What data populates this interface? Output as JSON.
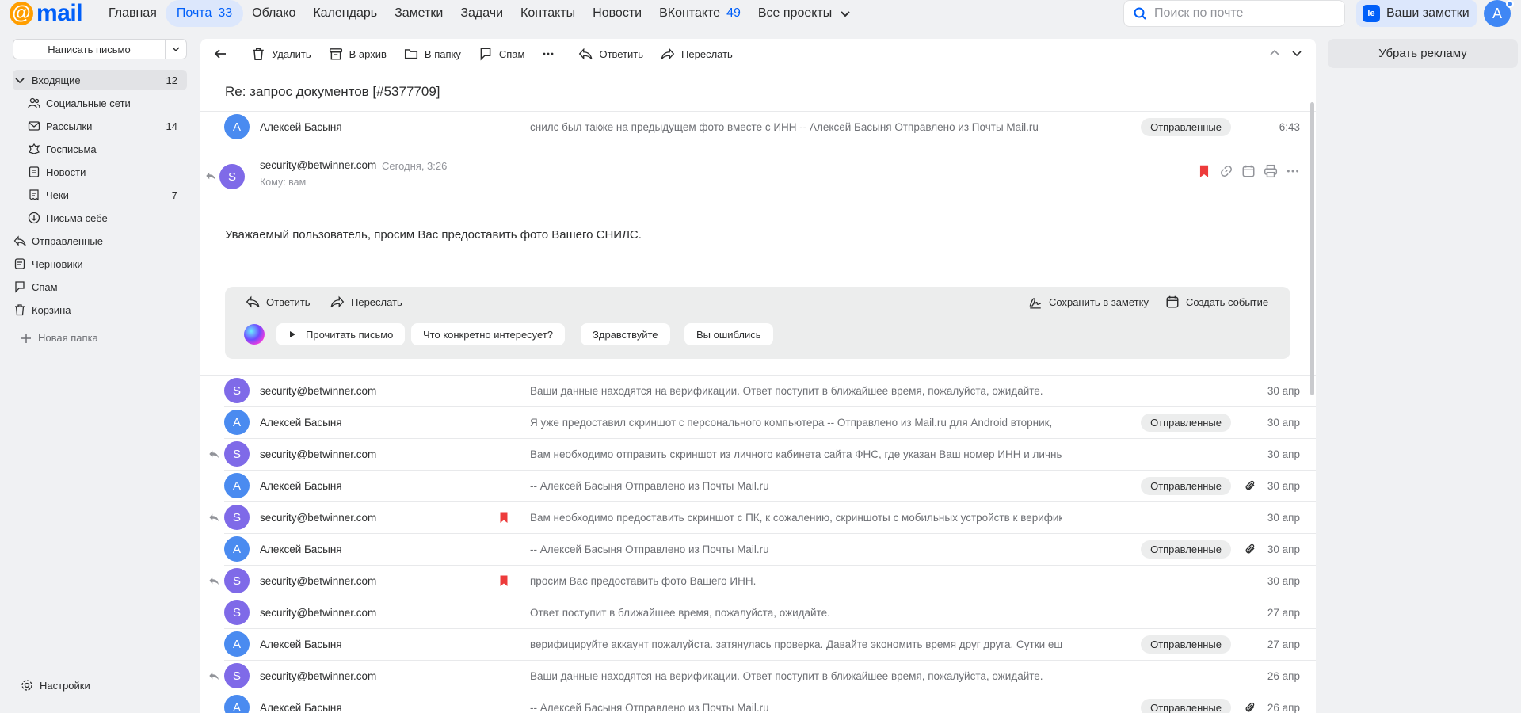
{
  "brand": {
    "logo_at": "@",
    "logo_word": "mail"
  },
  "nav": [
    {
      "label": "Главная",
      "count": ""
    },
    {
      "label": "Почта",
      "count": "33",
      "active": true
    },
    {
      "label": "Облако",
      "count": ""
    },
    {
      "label": "Календарь",
      "count": ""
    },
    {
      "label": "Заметки",
      "count": ""
    },
    {
      "label": "Задачи",
      "count": ""
    },
    {
      "label": "Контакты",
      "count": ""
    },
    {
      "label": "Новости",
      "count": ""
    },
    {
      "label": "ВКонтакте",
      "count": "49"
    },
    {
      "label": "Все проекты",
      "count": ""
    }
  ],
  "search": {
    "placeholder": "Поиск по почте"
  },
  "notes_button": {
    "icon_text": "le",
    "label": "Ваши заметки"
  },
  "user": {
    "avatar": "A"
  },
  "compose": {
    "label": "Написать письмо"
  },
  "folders": [
    {
      "label": "Входящие",
      "count": "12"
    },
    {
      "label": "Социальные сети",
      "count": ""
    },
    {
      "label": "Рассылки",
      "count": "14"
    },
    {
      "label": "Госписьма",
      "count": ""
    },
    {
      "label": "Новости",
      "count": ""
    },
    {
      "label": "Чеки",
      "count": "7"
    },
    {
      "label": "Письма себе",
      "count": ""
    },
    {
      "label": "Отправленные",
      "count": ""
    },
    {
      "label": "Черновики",
      "count": ""
    },
    {
      "label": "Спам",
      "count": ""
    },
    {
      "label": "Корзина",
      "count": ""
    }
  ],
  "new_folder": "Новая папка",
  "settings": "Настройки",
  "toolbar": {
    "delete": "Удалить",
    "archive": "В архив",
    "to_folder": "В папку",
    "spam": "Спам",
    "reply": "Ответить",
    "forward": "Переслать"
  },
  "thread": {
    "subject": "Re: запрос документов [#5377709]",
    "first": {
      "avatar": "A",
      "sender": "Алексей Басыня",
      "snippet": "снилс был также на предыдущем фото вместе с ИНН -- Алексей Басыня Отправлено из Почты Mail.ru",
      "tag": "Отправленные",
      "date": "6:43"
    },
    "open": {
      "avatar": "S",
      "from": "security@betwinner.com",
      "time": "Сегодня, 3:26",
      "to": "Кому: вам",
      "body": "Уважаемый пользователь, просим Вас предоставить фото Вашего СНИЛС."
    },
    "actions": {
      "reply": "Ответить",
      "forward": "Переслать",
      "save_note": "Сохранить в заметку",
      "create_event": "Создать событие",
      "read_letter": "Прочитать письмо",
      "chips": [
        "Что конкретно интересует?",
        "Здравствуйте",
        "Вы ошиблись"
      ]
    },
    "rows": [
      {
        "avatar": "S",
        "sender": "security@betwinner.com",
        "snippet": "Ваши данные находятся на верификации. Ответ поступит в ближайшее время, пожалуйста, ожидайте.",
        "tag": "",
        "date": "30 апр",
        "replied": false,
        "flag": false,
        "clip": false
      },
      {
        "avatar": "A",
        "sender": "Алексей Басыня",
        "snippet": "Я уже предоставил скриншот с персонального компьютера -- Отправлено из Mail.ru для Android вторник,",
        "tag": "Отправленные",
        "date": "30 апр",
        "replied": false,
        "flag": false,
        "clip": false
      },
      {
        "avatar": "S",
        "sender": "security@betwinner.com",
        "snippet": "Вам необходимо отправить скриншот из личного кабинета сайта ФНС, где указан Ваш номер ИНН и личные д",
        "tag": "",
        "date": "30 апр",
        "replied": true,
        "flag": false,
        "clip": false
      },
      {
        "avatar": "A",
        "sender": "Алексей Басыня",
        "snippet": "-- Алексей Басыня Отправлено из Почты Mail.ru",
        "tag": "Отправленные",
        "date": "30 апр",
        "replied": false,
        "flag": false,
        "clip": true
      },
      {
        "avatar": "S",
        "sender": "security@betwinner.com",
        "snippet": "Вам необходимо предоставить скриншот с ПК, к сожалению, скриншоты с мобильных устройств к верификаци",
        "tag": "",
        "date": "30 апр",
        "replied": true,
        "flag": true,
        "clip": false
      },
      {
        "avatar": "A",
        "sender": "Алексей Басыня",
        "snippet": "-- Алексей Басыня Отправлено из Почты Mail.ru",
        "tag": "Отправленные",
        "date": "30 апр",
        "replied": false,
        "flag": false,
        "clip": true
      },
      {
        "avatar": "S",
        "sender": "security@betwinner.com",
        "snippet": "просим Вас предоставить фото Вашего ИНН.",
        "tag": "",
        "date": "30 апр",
        "replied": true,
        "flag": true,
        "clip": false
      },
      {
        "avatar": "S",
        "sender": "security@betwinner.com",
        "snippet": "Ответ поступит в ближайшее время, пожалуйста, ожидайте.",
        "tag": "",
        "date": "27 апр",
        "replied": false,
        "flag": false,
        "clip": false
      },
      {
        "avatar": "A",
        "sender": "Алексей Басыня",
        "snippet": "верифицируйте аккаунт пожалуйста. затянулась проверка. Давайте экономить время друг друга. Сутки еще",
        "tag": "Отправленные",
        "date": "27 апр",
        "replied": false,
        "flag": false,
        "clip": false
      },
      {
        "avatar": "S",
        "sender": "security@betwinner.com",
        "snippet": "Ваши данные находятся на верификации. Ответ поступит в ближайшее время, пожалуйста, ожидайте.",
        "tag": "",
        "date": "26 апр",
        "replied": true,
        "flag": false,
        "clip": false
      },
      {
        "avatar": "A",
        "sender": "Алексей Басыня",
        "snippet": "-- Алексей Басыня Отправлено из Почты Mail.ru",
        "tag": "Отправленные",
        "date": "26 апр",
        "replied": false,
        "flag": false,
        "clip": true
      }
    ]
  },
  "ad": {
    "remove_label": "Убрать рекламу"
  },
  "colors": {
    "accent": "#005ff9",
    "flag": "#ed3b3b",
    "avatar_a": "#4a8bf0",
    "avatar_s": "#7f6ae8"
  }
}
